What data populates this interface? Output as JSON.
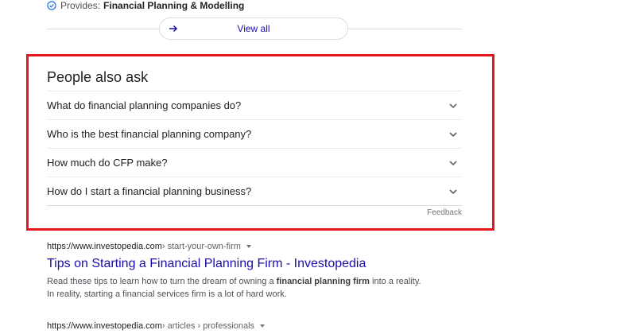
{
  "provides": {
    "label": "Provides:",
    "value": "Financial Planning & Modelling",
    "icon": "check-circle-icon"
  },
  "view_all": {
    "label": "View all",
    "icon": "arrow-right-icon"
  },
  "highlight_color": "#e3161b",
  "paa": {
    "title": "People also ask",
    "questions": [
      "What do financial planning companies do?",
      "Who is the best financial planning company?",
      "How much do CFP make?",
      "How do I start a financial planning business?"
    ],
    "feedback": "Feedback"
  },
  "results": [
    {
      "domain": "https://www.investopedia.com",
      "path": " › start-your-own-firm",
      "title": "Tips on Starting a Financial Planning Firm - Investopedia",
      "snippet_line1_pre": "Read these tips to learn how to turn the dream of owning a ",
      "snippet_line1_bold": "financial planning firm",
      "snippet_line1_post": " into a reality.",
      "snippet_line2": "In reality, starting a financial services firm is a lot of hard work."
    },
    {
      "domain": "https://www.investopedia.com",
      "path": " › articles › professionals"
    }
  ],
  "colors": {
    "link": "#1a0dab",
    "text": "#202124",
    "muted": "#70757a"
  }
}
